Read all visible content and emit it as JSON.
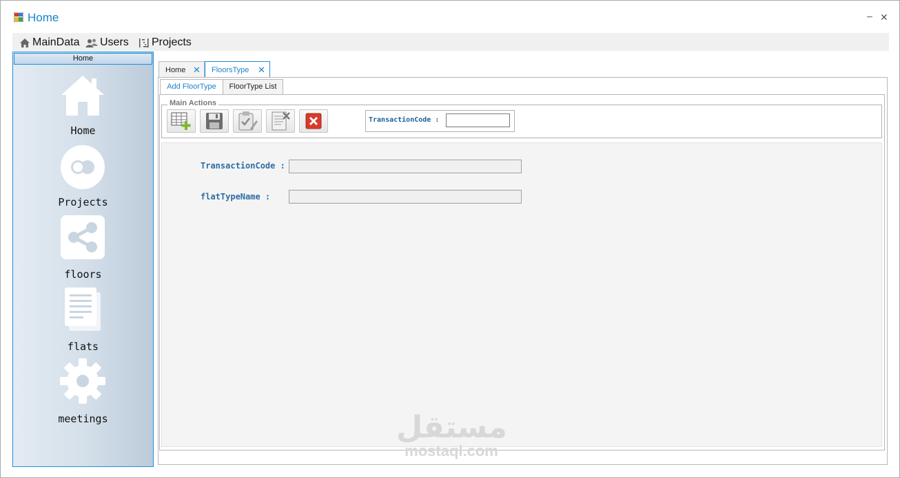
{
  "window": {
    "title": "Home",
    "minimize": "–",
    "close": "✕"
  },
  "menu": [
    {
      "label": "MainData",
      "icon": "home-icon"
    },
    {
      "label": "Users",
      "icon": "users-icon"
    },
    {
      "label": "Projects",
      "icon": "tree-icon"
    }
  ],
  "sidebar": {
    "header": "Home",
    "items": [
      {
        "label": "Home",
        "icon": "house-icon"
      },
      {
        "label": "Projects",
        "icon": "circles-icon"
      },
      {
        "label": "floors",
        "icon": "share-icon"
      },
      {
        "label": "flats",
        "icon": "document-icon"
      },
      {
        "label": "meetings",
        "icon": "gear-icon"
      }
    ]
  },
  "tabs": [
    {
      "label": "Home",
      "close": "✕",
      "active": false
    },
    {
      "label": "FloorsType",
      "close": "✕",
      "active": true
    }
  ],
  "subtabs": [
    {
      "label": "Add FloorType",
      "active": true
    },
    {
      "label": "FloorType List",
      "active": false
    }
  ],
  "actions": {
    "group_title": "Main Actions",
    "buttons": [
      "add-grid-icon",
      "save-icon",
      "edit-clipboard-icon",
      "delete-document-icon",
      "cancel-icon"
    ],
    "transaction_label": "TransactionCode :",
    "transaction_value": ""
  },
  "form": {
    "fields": [
      {
        "label": "TransactionCode :",
        "value": ""
      },
      {
        "label": "flatTypeName :",
        "value": ""
      }
    ]
  },
  "watermark": {
    "arabic": "مستقل",
    "latin": "mostaql.com"
  },
  "colors": {
    "accent": "#1a83c9",
    "label": "#2e6da4",
    "sidebar_border": "#1e90d6"
  }
}
